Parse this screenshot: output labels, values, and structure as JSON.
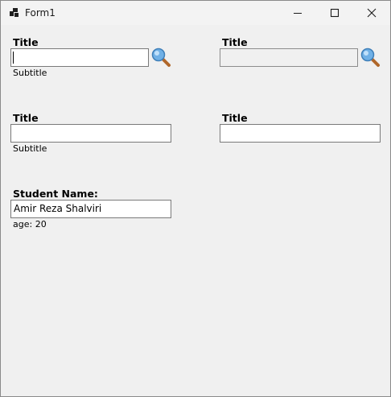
{
  "window": {
    "title": "Form1",
    "icon": "winforms-app-icon",
    "buttons": [
      "minimize-icon",
      "maximize-icon",
      "close-icon"
    ]
  },
  "fields": [
    {
      "title": "Title",
      "value": "",
      "subtitle": "Subtitle",
      "has_search": true,
      "enabled": true,
      "focused": true
    },
    {
      "title": "Title",
      "value": "",
      "subtitle": "",
      "has_search": true,
      "enabled": false
    },
    {
      "title": "Title",
      "value": "",
      "subtitle": "Subtitle",
      "has_search": false,
      "enabled": true
    },
    {
      "title": "Title",
      "value": "",
      "subtitle": "",
      "has_search": false,
      "enabled": true
    },
    {
      "title": "Student Name:",
      "value": "Amir Reza Shalviri",
      "subtitle": "age: 20",
      "has_search": false,
      "enabled": true
    }
  ],
  "icons": {
    "search": "magnifier-icon"
  },
  "colors": {
    "background": "#f0f0f0",
    "titlebar": "#f3f3f3",
    "field_border": "#7a7a7a",
    "magnifier_lens": "#6fb0e6",
    "magnifier_handle": "#b0672a"
  }
}
